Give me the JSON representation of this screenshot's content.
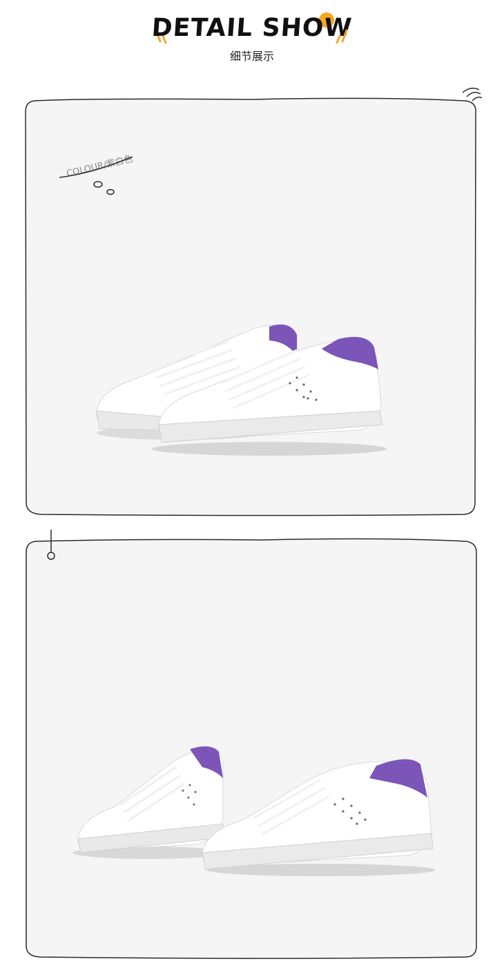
{
  "header": {
    "title": "DETAIL SHOW",
    "subtitle": "细节展示"
  },
  "panel1": {
    "colour_label": "COLOUR/紫白色"
  },
  "colors": {
    "background": "#ffffff",
    "panel_fill": "#f5f5f5",
    "outline": "#2a2a2a",
    "accent_orange": "#f5a623",
    "shoe_white": "#ffffff",
    "shoe_heel_purple": "#7b55b8",
    "sole": "#e9e9e9"
  },
  "icons": [
    "sparkle-lines-icon",
    "thought-bubble-icon",
    "pin-icon",
    "decor-lines-icon"
  ]
}
